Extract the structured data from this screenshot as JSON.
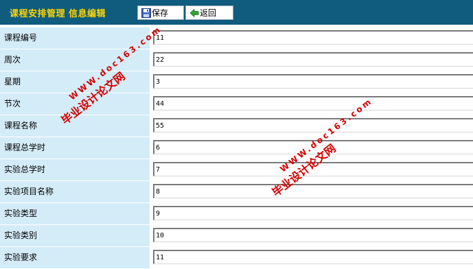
{
  "header": {
    "title": "课程安排管理  信息编辑",
    "save_label": "保存",
    "back_label": "返回"
  },
  "form": {
    "fields": [
      {
        "label": "课程编号",
        "value": "11"
      },
      {
        "label": "周次",
        "value": "22"
      },
      {
        "label": "星期",
        "value": "3"
      },
      {
        "label": "节次",
        "value": "44"
      },
      {
        "label": "课程名称",
        "value": "55"
      },
      {
        "label": "课程总学时",
        "value": "6"
      },
      {
        "label": "实验总学时",
        "value": "7"
      },
      {
        "label": "实验项目名称",
        "value": "8"
      },
      {
        "label": "实验类型",
        "value": "9"
      },
      {
        "label": "实验类别",
        "value": "10"
      },
      {
        "label": "实验要求",
        "value": "11"
      }
    ]
  },
  "watermarks": [
    {
      "cn": "毕业设计论文网",
      "en": "WWW.doc163.com"
    },
    {
      "cn": "毕业设计论文网",
      "en": "WWW.doc163.com"
    }
  ],
  "colors": {
    "header_bg": "#0f5c7f",
    "title_color": "#ffd400",
    "label_bg": "#d4ecf8",
    "watermark": "#d40000"
  }
}
